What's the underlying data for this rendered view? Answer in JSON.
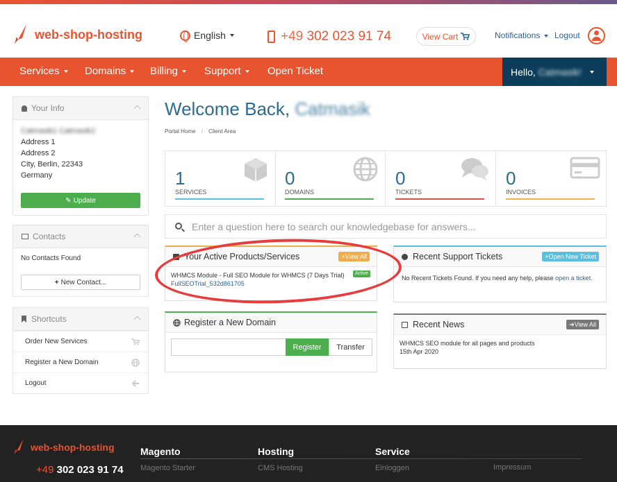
{
  "brand": {
    "name": "web-shop-hosting",
    "accent": "#e8542f",
    "nav_dark": "#0c3e5c"
  },
  "header": {
    "language": "English",
    "phone_prefix": "+49",
    "phone_number": "302 023 91 74",
    "cart_label": "View Cart",
    "notifications_label": "Notifications",
    "logout_label": "Logout"
  },
  "nav": {
    "items": [
      {
        "label": "Services"
      },
      {
        "label": "Domains"
      },
      {
        "label": "Billing"
      },
      {
        "label": "Support"
      },
      {
        "label": "Open Ticket"
      }
    ],
    "hello_label": "Hello,",
    "hello_name": "Catmasik!"
  },
  "sidebar": {
    "your_info": {
      "title": "Your Info",
      "name": "Catmasik1 Catmasik2",
      "address1": "Address 1",
      "address2": "Address 2",
      "city_line": "City, Berlin, 22343",
      "country": "Germany",
      "update_label": "Update"
    },
    "contacts": {
      "title": "Contacts",
      "empty_text": "No Contacts Found",
      "new_label": "New Contact..."
    },
    "shortcuts": {
      "title": "Shortcuts",
      "items": [
        {
          "label": "Order New Services",
          "icon": "cart-icon"
        },
        {
          "label": "Register a New Domain",
          "icon": "globe-icon"
        },
        {
          "label": "Logout",
          "icon": "arrow-left-icon"
        }
      ]
    }
  },
  "main": {
    "welcome_prefix": "Welcome Back,",
    "welcome_name": "Catmasik",
    "breadcrumb": [
      "Portal Home",
      "Client Area"
    ],
    "tiles": [
      {
        "count": "1",
        "label": "SERVICES",
        "color": "#5bc0de",
        "icon": "cube-icon"
      },
      {
        "count": "0",
        "label": "DOMAINS",
        "color": "#4cae4c",
        "icon": "globe-icon"
      },
      {
        "count": "0",
        "label": "TICKETS",
        "color": "#d9534f",
        "icon": "comments-icon"
      },
      {
        "count": "0",
        "label": "INVOICES",
        "color": "#f0ad4e",
        "icon": "credit-card-icon"
      }
    ],
    "search_placeholder": "Enter a question here to search our knowledgebase for answers...",
    "products": {
      "title": "Your Active Products/Services",
      "view_all": "View All",
      "item_name": "WHMCS Module - Full SEO Module for WHMCS (7 Days Trial)",
      "item_link": "FullSEOTrial_532d861705",
      "status": "Active"
    },
    "tickets": {
      "title": "Recent Support Tickets",
      "new_label": "Open New Ticket",
      "empty_text": "No Recent Tickets Found. If you need any help, please",
      "open_link": "open a ticket."
    },
    "domain": {
      "title": "Register a New Domain",
      "register_label": "Register",
      "transfer_label": "Transfer"
    },
    "news": {
      "title": "Recent News",
      "view_all": "View All",
      "item_title": "WHMCS SEO module for all pages and products",
      "item_date": "15th Apr 2020"
    }
  },
  "footer": {
    "brand": "web-shop-hosting",
    "phone_prefix": "+49",
    "phone_number": "302 023 91 74",
    "cols": [
      {
        "title": "Magento",
        "link": "Magento Starter"
      },
      {
        "title": "Hosting",
        "link": "CMS Hosting"
      },
      {
        "title": "Service",
        "link": "Einloggen"
      }
    ],
    "extra_link": "Impressum"
  }
}
